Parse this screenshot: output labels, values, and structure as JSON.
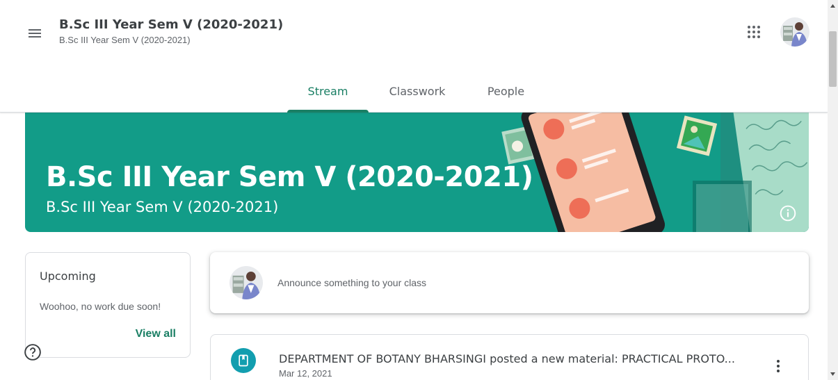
{
  "header": {
    "title": "B.Sc III Year Sem V (2020-2021)",
    "subtitle": "B.Sc III Year Sem V (2020-2021)",
    "menu_icon": "hamburger-menu-icon",
    "apps_icon": "apps-grid-icon",
    "avatar": "user-avatar"
  },
  "tabs": [
    {
      "label": "Stream",
      "active": true
    },
    {
      "label": "Classwork",
      "active": false
    },
    {
      "label": "People",
      "active": false
    }
  ],
  "banner": {
    "title": "B.Sc III Year Sem V (2020-2021)",
    "subtitle": "B.Sc III Year Sem V (2020-2021)",
    "color": "#129c88",
    "info_icon": "info-icon"
  },
  "upcoming": {
    "title": "Upcoming",
    "message": "Woohoo, no work due soon!",
    "link": "View all"
  },
  "announce": {
    "placeholder": "Announce something to your class"
  },
  "posts": [
    {
      "title": "DEPARTMENT OF BOTANY BHARSINGI posted a new material: PRACTICAL PROTO...",
      "date": "Mar 12, 2021",
      "icon": "material-book-icon"
    }
  ],
  "colors": {
    "accent": "#1a7f64",
    "banner": "#129c88",
    "post_icon": "#129eaf"
  }
}
